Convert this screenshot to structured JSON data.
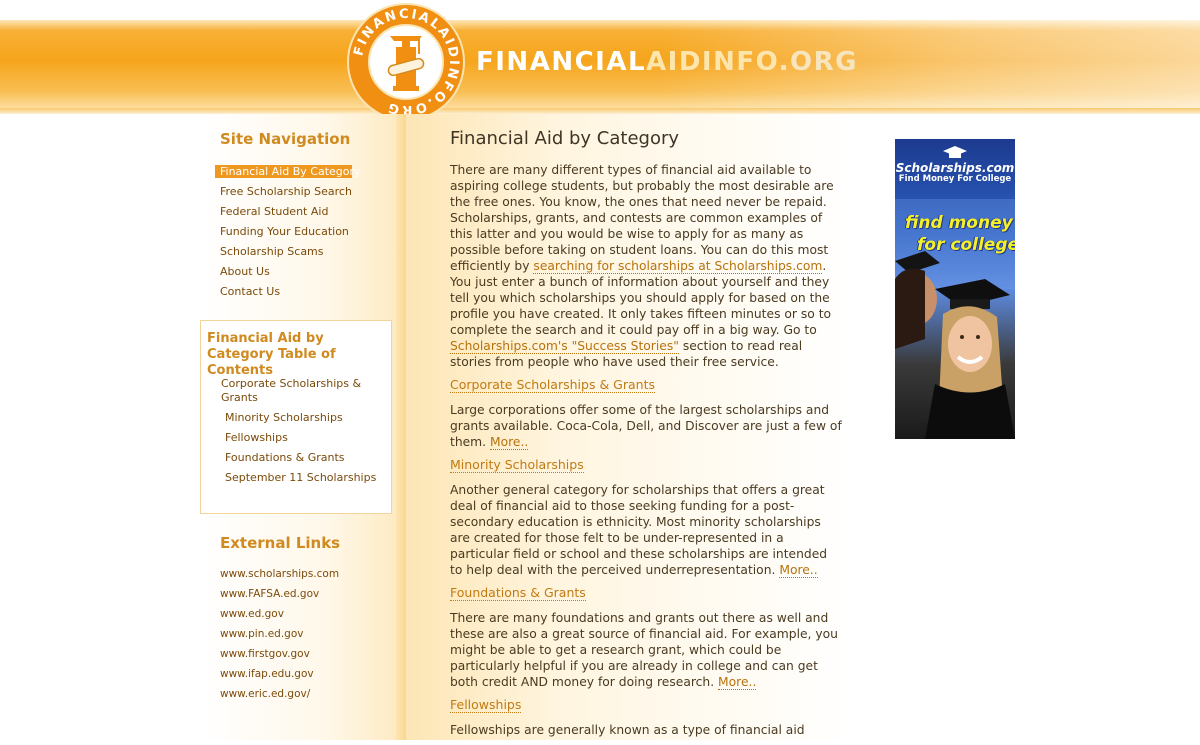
{
  "header": {
    "logo_text_1": "FINANCIAL",
    "logo_text_2": "AIDINFO",
    "logo_text_3": ".ORG",
    "seal_text": "FINANCIALAIDINFO.ORG"
  },
  "sidebar": {
    "nav_heading": "Site Navigation",
    "nav_items": [
      "Financial Aid By Category",
      "Free Scholarship Search",
      "Federal Student Aid",
      "Funding Your Education",
      "Scholarship Scams",
      "About Us",
      "Contact Us"
    ],
    "toc_title": "Financial Aid by Category Table of Contents",
    "toc_items": [
      "Corporate Scholarships & Grants",
      "Minority Scholarships",
      "Fellowships",
      "Foundations & Grants",
      "September 11 Scholarships"
    ],
    "ext_heading": "External Links",
    "ext_links": [
      "www.scholarships.com",
      "www.FAFSA.ed.gov",
      "www.ed.gov",
      "www.pin.ed.gov",
      "www.firstgov.gov",
      "www.ifap.edu.gov",
      "www.eric.ed.gov/"
    ]
  },
  "main": {
    "title": "Financial Aid by Category",
    "intro": {
      "part1": "There are many different types of financial aid available to aspiring college students, but probably the most desirable are the free ones. You know, the ones that need never be repaid. Scholarships, grants, and contests are common examples of this latter and you would be wise to apply for as many as possible before taking on student loans. You can do this most efficiently by ",
      "link1": "searching for scholarships at Scholarships.com",
      "part2": ". You just enter a bunch of information about yourself and they tell you which scholarships you should apply for based on the profile you have created. It only takes fifteen minutes or so to complete the search and it could pay off in a big way. Go to ",
      "link2": "Scholarships.com's \"Success Stories\"",
      "part3": " section to read real stories from people who have used their free service."
    },
    "sections": [
      {
        "heading": "Corporate Scholarships & Grants",
        "text": "Large corporations offer some of the largest scholarships and grants available. Coca-Cola, Dell, and Discover are just a few of them. ",
        "more": "More.."
      },
      {
        "heading": "Minority Scholarships",
        "text": "Another general category for scholarships that offers a great deal of financial aid to those seeking funding for a post-secondary education is ethnicity. Most minority scholarships are created for those felt to be under-represented in a particular field or school and these scholarships are intended to help deal with the perceived underrepresentation. ",
        "more": "More.."
      },
      {
        "heading": "Foundations & Grants",
        "text": "There are many foundations and grants out there as well and these are also a great source of financial aid. For example, you might be able to get a research grant, which could be particularly helpful if you are already in college and can get both credit AND money for doing research. ",
        "more": "More.."
      },
      {
        "heading": "Fellowships",
        "text": "Fellowships are generally known as a type of financial aid",
        "more": ""
      }
    ]
  },
  "ad": {
    "brand": "Scholarships.com",
    "tagline": "Find Money For College",
    "slogan_1": "find money",
    "slogan_2": "for college."
  },
  "colors": {
    "accent_orange": "#ee9820",
    "heading_orange": "#d08a1f",
    "link_brown": "#b8720c"
  }
}
